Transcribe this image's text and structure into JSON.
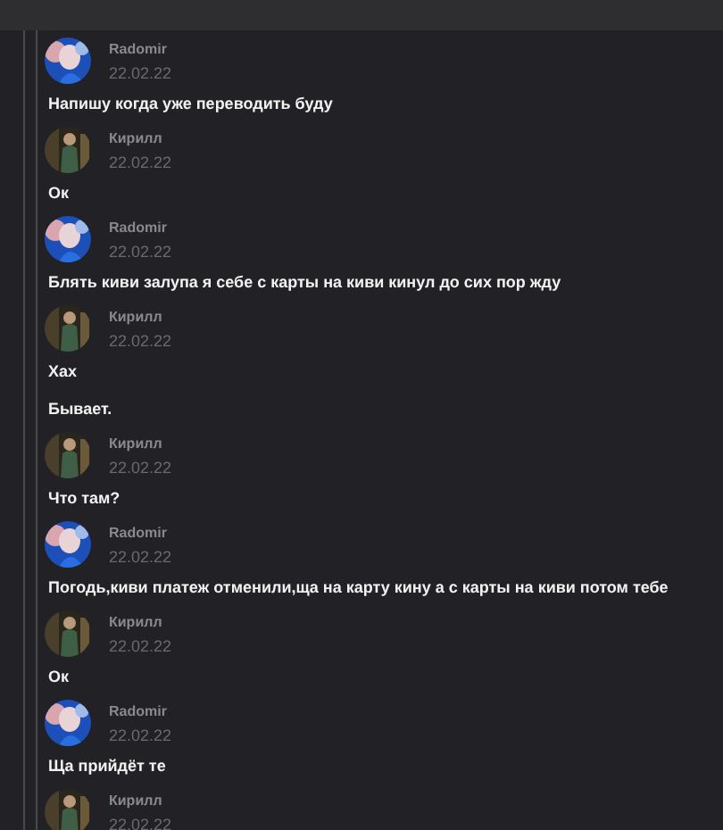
{
  "thread": [
    {
      "author": "Radomir",
      "date": "22.02.22",
      "avatar": {
        "kind": "picture"
      },
      "messages": [
        "Напишу когда уже переводить буду"
      ]
    },
    {
      "author": "Кирилл",
      "date": "22.02.22",
      "avatar": {
        "kind": "picture"
      },
      "messages": [
        "Ок"
      ]
    },
    {
      "author": "Radomir",
      "date": "22.02.22",
      "avatar": {
        "kind": "picture"
      },
      "messages": [
        "Блять киви залупа я себе с карты на киви кинул до сих пор жду"
      ]
    },
    {
      "author": "Кирилл",
      "date": "22.02.22",
      "avatar": {
        "kind": "picture"
      },
      "messages": [
        "Хах",
        "Бывает."
      ]
    },
    {
      "author": "Кирилл",
      "date": "22.02.22",
      "avatar": {
        "kind": "picture"
      },
      "messages": [
        "Что там?"
      ]
    },
    {
      "author": "Radomir",
      "date": "22.02.22",
      "avatar": {
        "kind": "picture"
      },
      "messages": [
        "Погодь,киви платеж отменили,ща на карту кину а с карты на киви потом тебе"
      ]
    },
    {
      "author": "Кирилл",
      "date": "22.02.22",
      "avatar": {
        "kind": "picture"
      },
      "messages": [
        "Ок"
      ]
    },
    {
      "author": "Radomir",
      "date": "22.02.22",
      "avatar": {
        "kind": "picture"
      },
      "messages": [
        "Ща прийдёт те"
      ]
    },
    {
      "author": "Кирилл",
      "date": "22.02.22",
      "avatar": {
        "kind": "picture"
      }
    }
  ]
}
